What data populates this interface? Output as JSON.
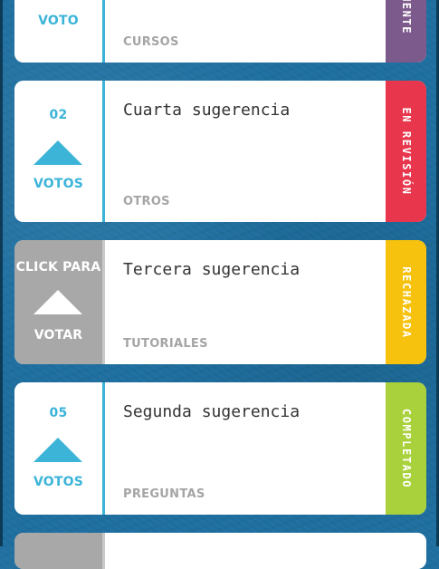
{
  "suggestions": [
    {
      "count": "",
      "vote_label": "VOTO",
      "title": "",
      "category": "CURSOS",
      "status": "MENTE",
      "status_color": "#7d5a8c",
      "style": "normal"
    },
    {
      "count": "02",
      "vote_label": "VOTOS",
      "title": "Cuarta sugerencia",
      "category": "OTROS",
      "status": "EN REVISIÓN",
      "status_color": "#e8374d",
      "style": "normal"
    },
    {
      "count": "CLICK PARA",
      "vote_label": "VOTAR",
      "title": "Tercera sugerencia",
      "category": "TUTORIALES",
      "status": "RECHAZADA",
      "status_color": "#f6c20d",
      "style": "grey"
    },
    {
      "count": "05",
      "vote_label": "VOTOS",
      "title": "Segunda sugerencia",
      "category": "PREGUNTAS",
      "status": "COMPLETADO",
      "status_color": "#a9d13b",
      "style": "normal"
    },
    {
      "count": "",
      "vote_label": "",
      "title": "",
      "category": "",
      "status": "",
      "status_color": "#ffffff",
      "style": "grey"
    }
  ]
}
